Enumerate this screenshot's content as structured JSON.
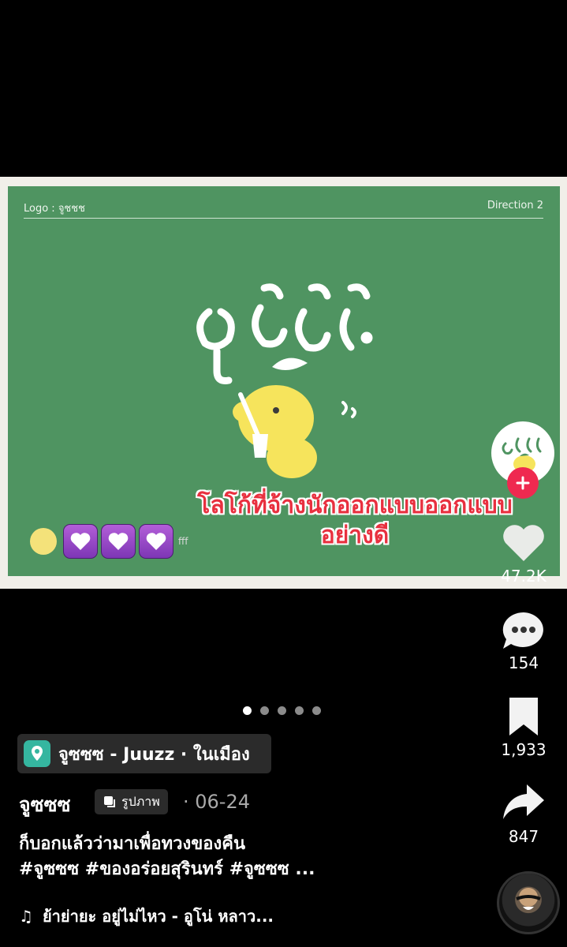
{
  "slide": {
    "header_left": "Logo : จูชชช",
    "header_right": "Direction 2",
    "overlay_caption_line1": "โลโก้ที่จ้างนักออกแบบออกแบบ",
    "overlay_caption_line2": "อย่างดี",
    "emoji_trail": "fff"
  },
  "rail": {
    "likes": "47.2K",
    "comments": "154",
    "bookmarks": "1,933",
    "shares": "847"
  },
  "carousel": {
    "total": 5,
    "active": 1
  },
  "location": {
    "label": "จูซซซ - Juuzz · ในเมือง"
  },
  "post": {
    "author": "จูซซซ",
    "type_badge": "รูปภาพ",
    "date": "· 06-24",
    "caption_line1": "ก็บอกแล้วว่ามาเพื่อทวงของคืน",
    "caption_line2": "#จูซซซ #ของอร่อยสุรินทร์ #จูซซซ ..."
  },
  "music": {
    "title": "ย้าย่ายะ อยู่ไม่ไหว - อูโน่ หลาว..."
  },
  "colors": {
    "slide_green": "#4f9461",
    "caption_red": "#e8303f",
    "follow_pink": "#ef2950",
    "location_teal": "#35b6a0"
  }
}
